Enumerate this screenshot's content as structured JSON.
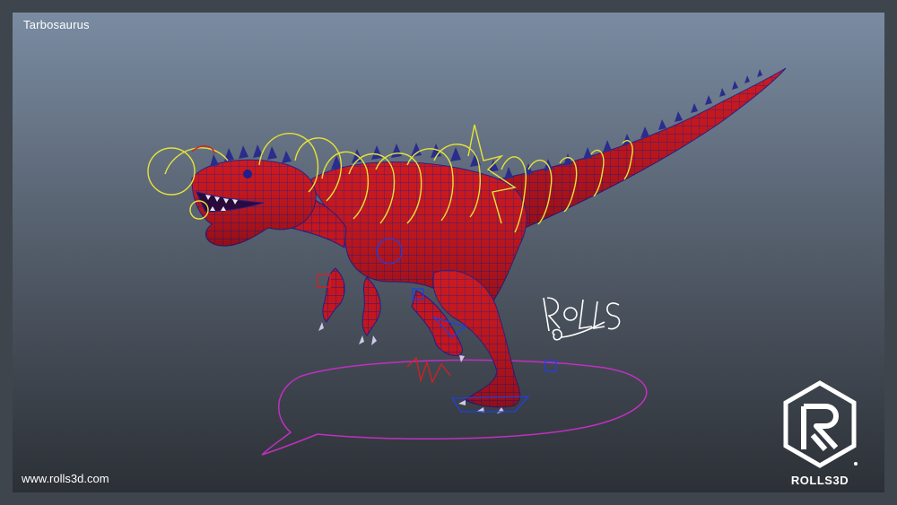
{
  "viewport": {
    "title": "Tarbosaurus"
  },
  "footer": {
    "url": "www.rolls3d.com"
  },
  "brand": {
    "name": "ROLLS3D",
    "logo_icon": "rolls3d-hexagon-logo-icon",
    "signature_icon": "rolls-signature-icon"
  },
  "model": {
    "icon": "tarbosaurus-wireframe-model",
    "body_color": "#c4161c",
    "wire_color": "#1d1f8c",
    "control_yellow": "#e6e33a",
    "control_magenta": "#c030c0",
    "control_red": "#d52020",
    "control_blue": "#2040e0"
  }
}
